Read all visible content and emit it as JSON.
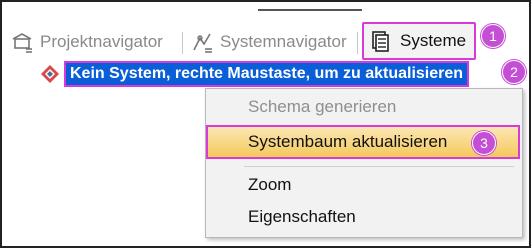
{
  "tabs": [
    {
      "label": "Projektnavigator",
      "icon": "project-navigator-icon"
    },
    {
      "label": "Systemnavigator",
      "icon": "system-navigator-icon"
    },
    {
      "label": "Systeme",
      "icon": "systems-icon"
    }
  ],
  "tree": {
    "root_label": "Kein System, rechte Maustaste, um zu aktualisieren",
    "icon": "system-tree-icon"
  },
  "context_menu": {
    "items": [
      {
        "label": "Schema generieren",
        "disabled": true
      },
      {
        "label": "Systembaum aktualisieren",
        "highlighted": true
      },
      {
        "label": "Zoom"
      },
      {
        "label": "Eigenschaften"
      }
    ]
  },
  "callouts": [
    "1",
    "2",
    "3"
  ],
  "colors": {
    "callout": "#c54fd4",
    "selection": "#0a5fd8",
    "highlight": "#f5c85a"
  }
}
